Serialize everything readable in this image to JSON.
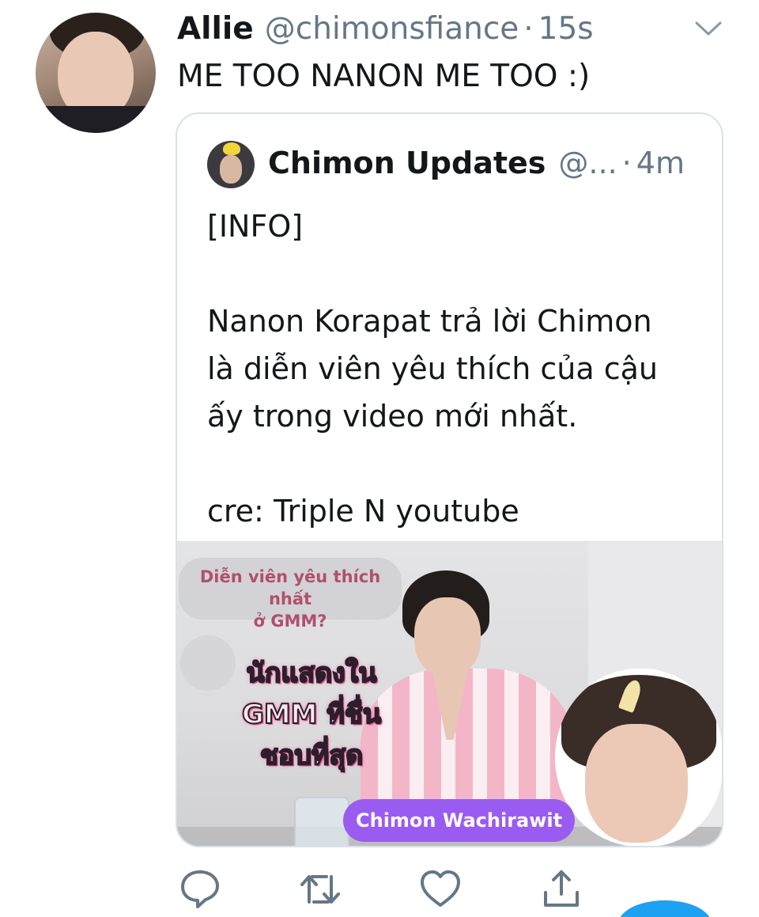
{
  "tweet": {
    "author_name": "Allie",
    "author_handle": "@chimonsfiance",
    "separator": "·",
    "time": "15s",
    "text": "ME TOO NANON ME TOO :)"
  },
  "quoted_tweet": {
    "author_name": "Chimon Updates",
    "author_handle": "@...",
    "separator": "·",
    "time": "4m",
    "lines": [
      "[INFO]",
      "",
      "Nanon Korapat trả lời Chimon",
      "là diễn viên yêu thích của cậu",
      "ấy trong video mới nhất.",
      "",
      "cre: Triple N youtube"
    ],
    "media": {
      "caption_question": "Diễn viên yêu thích nhất ở GMM?",
      "caption_question_line1": "Diễn viên yêu thích nhất",
      "caption_question_line2": "ở GMM?",
      "sticker_line1": "นักแสดงใน",
      "sticker_line2": "GMM ที่ชื่นชอบที่สุด",
      "name_tag": "Chimon Wachirawit"
    }
  },
  "actions": {
    "reply_icon": "speech-bubble-icon",
    "retweet_icon": "retweet-arrows-icon",
    "like_icon": "heart-icon",
    "share_icon": "share-upload-icon"
  },
  "colors": {
    "text_primary": "#14171a",
    "text_secondary": "#657786",
    "border": "#d9e1e8",
    "brand_blue": "#1da1f2",
    "name_tag_purple": "#9a5cf0"
  }
}
